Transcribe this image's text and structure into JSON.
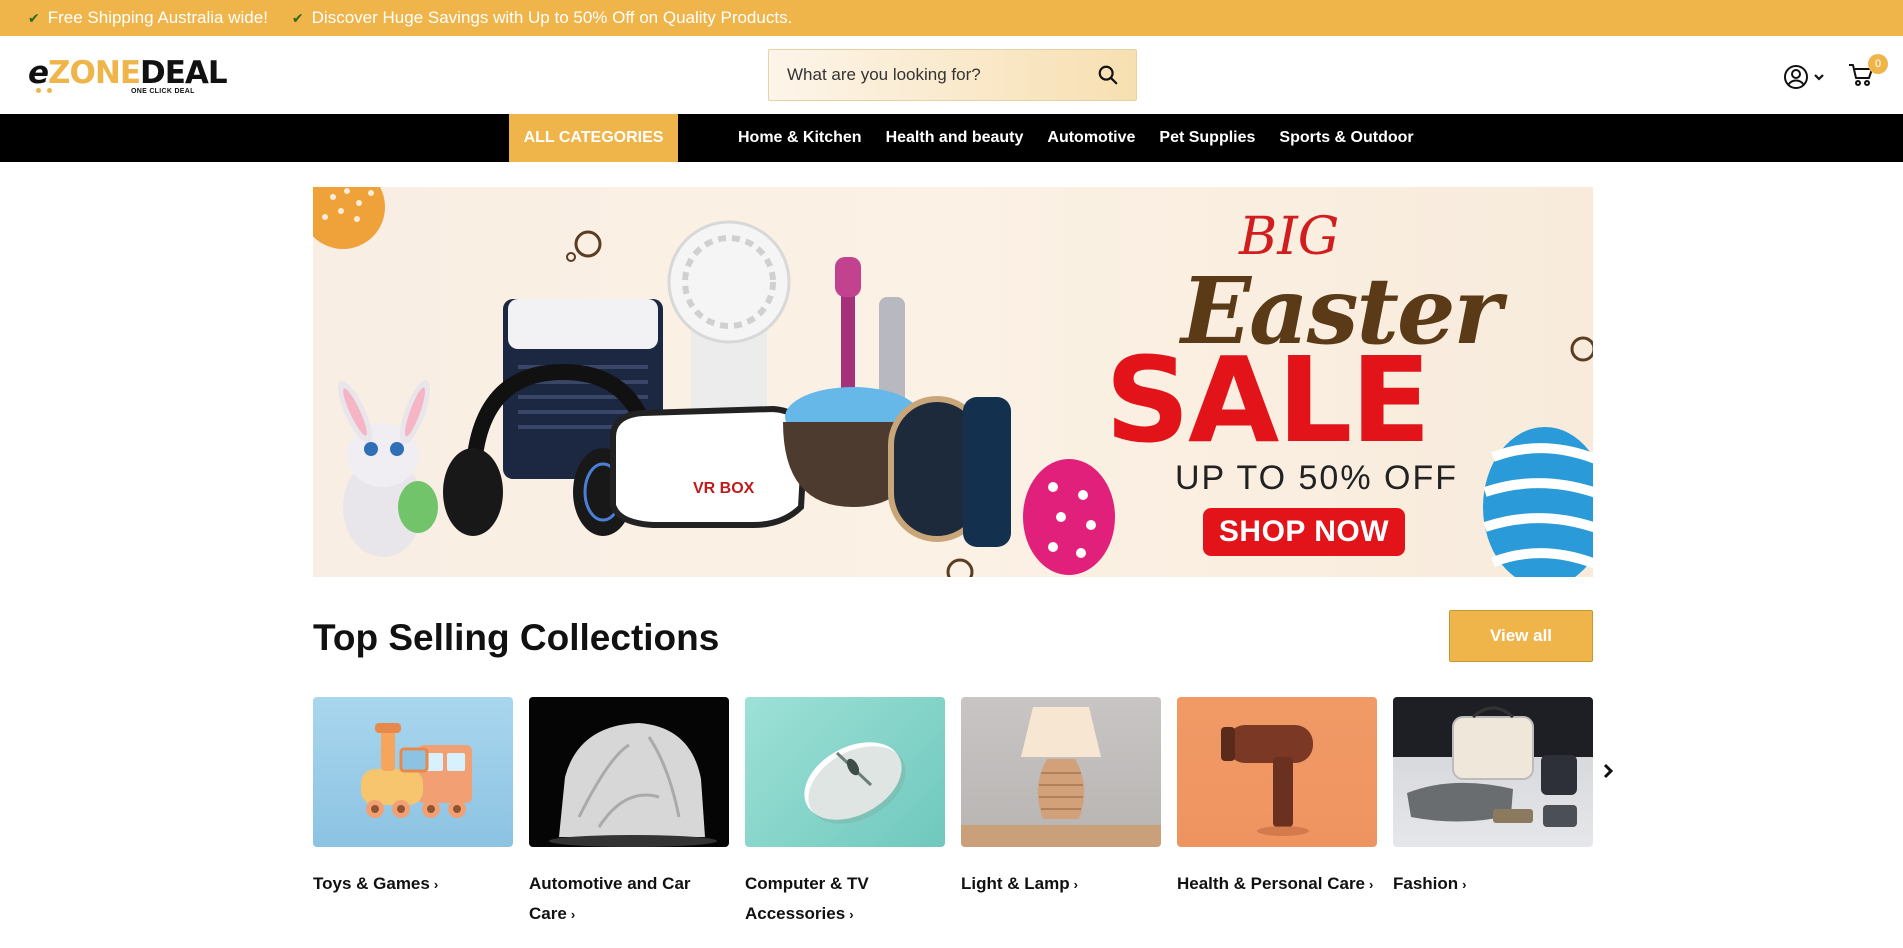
{
  "announcement": {
    "items": [
      "Free Shipping Australia wide!",
      "Discover Huge Savings with Up to 50% Off on Quality Products."
    ]
  },
  "header": {
    "logo": {
      "e": "e",
      "z": "Z",
      "one": "ONE",
      "deal": "DEAL",
      "tagline": "ONE CLICK DEAL"
    },
    "search": {
      "placeholder": "What are you looking for?"
    },
    "cart_count": "0"
  },
  "nav": {
    "all_categories": "ALL CATEGORIES",
    "links": [
      "Home & Kitchen",
      "Health and beauty",
      "Automotive",
      "Pet Supplies",
      "Sports & Outdoor"
    ]
  },
  "hero": {
    "big": "BIG",
    "easter": "Easter",
    "sale": "SALE",
    "offer": "UP TO 50% OFF",
    "cta": "SHOP NOW",
    "vr_label": "VR BOX"
  },
  "collections": {
    "title": "Top Selling Collections",
    "view_all": "View all",
    "items": [
      {
        "label": "Toys & Games"
      },
      {
        "label": "Automotive and Car Care"
      },
      {
        "label": "Computer & TV Accessories"
      },
      {
        "label": "Light & Lamp"
      },
      {
        "label": "Health & Personal Care"
      },
      {
        "label": "Fashion"
      }
    ]
  },
  "colors": {
    "accent": "#efb54a",
    "nav_bg": "#000000",
    "sale_red": "#e3131a"
  }
}
